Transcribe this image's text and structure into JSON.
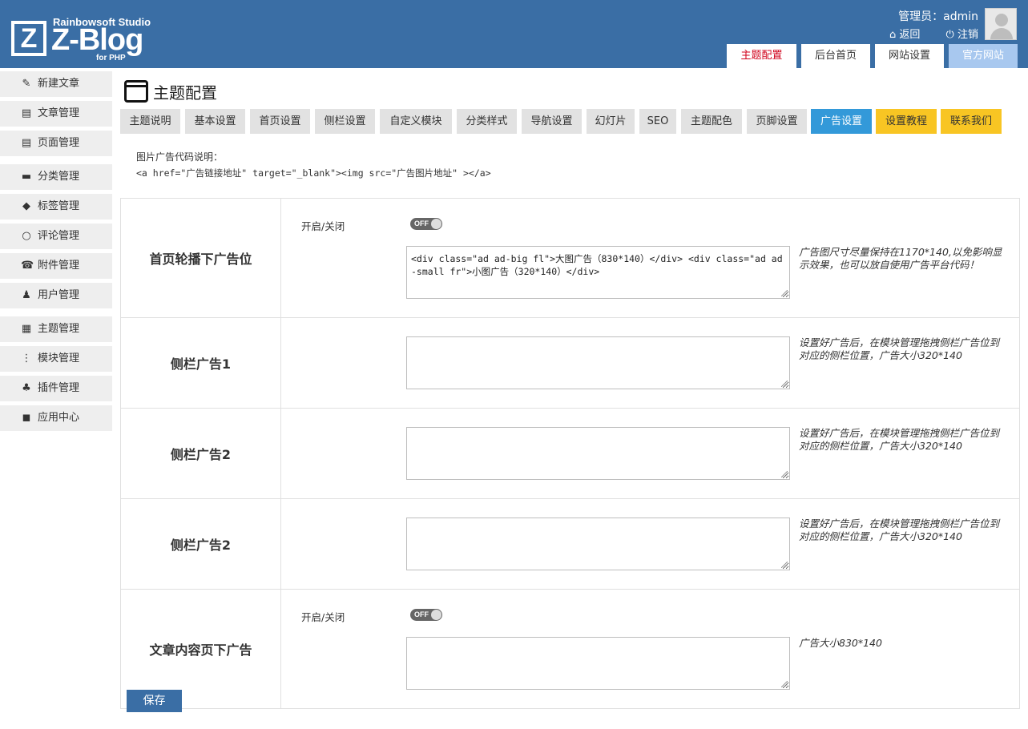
{
  "header": {
    "studio": "Rainbowsoft Studio",
    "brand": "Z-Blog",
    "brand_letter": "Z",
    "sub": "for PHP",
    "user_label": "管理员：admin",
    "back_label": "返回",
    "logout_label": "注销",
    "icons": {
      "back": "home-icon",
      "logout": "power-icon",
      "avatar": "avatar-icon"
    }
  },
  "top_tabs": [
    {
      "label": "主题配置",
      "active": true
    },
    {
      "label": "后台首页",
      "active": false
    },
    {
      "label": "网站设置",
      "active": false
    },
    {
      "label": "官方网站",
      "active": false
    }
  ],
  "sidebar": {
    "items": [
      {
        "label": "新建文章",
        "icon": "edit-icon",
        "glyph": "✎"
      },
      {
        "label": "文章管理",
        "icon": "article-icon",
        "glyph": "▤"
      },
      {
        "label": "页面管理",
        "icon": "page-icon",
        "glyph": "▤"
      },
      {
        "label": "分类管理",
        "icon": "folder-icon",
        "glyph": "▬"
      },
      {
        "label": "标签管理",
        "icon": "tag-icon",
        "glyph": "◆"
      },
      {
        "label": "评论管理",
        "icon": "comment-icon",
        "glyph": "○"
      },
      {
        "label": "附件管理",
        "icon": "attachment-icon",
        "glyph": "☎"
      },
      {
        "label": "用户管理",
        "icon": "user-icon",
        "glyph": "♟"
      },
      {
        "label": "主题管理",
        "icon": "theme-icon",
        "glyph": "▦"
      },
      {
        "label": "模块管理",
        "icon": "module-icon",
        "glyph": "⋮"
      },
      {
        "label": "插件管理",
        "icon": "plugin-icon",
        "glyph": "♣"
      },
      {
        "label": "应用中心",
        "icon": "app-center-icon",
        "glyph": "◼"
      }
    ]
  },
  "main": {
    "title": "主题配置",
    "tabs": [
      {
        "label": "主题说明",
        "style": "normal"
      },
      {
        "label": "基本设置",
        "style": "normal"
      },
      {
        "label": "首页设置",
        "style": "normal"
      },
      {
        "label": "侧栏设置",
        "style": "normal"
      },
      {
        "label": "自定义模块",
        "style": "normal"
      },
      {
        "label": "分类样式",
        "style": "normal"
      },
      {
        "label": "导航设置",
        "style": "normal"
      },
      {
        "label": "幻灯片",
        "style": "normal"
      },
      {
        "label": "SEO",
        "style": "normal"
      },
      {
        "label": "主题配色",
        "style": "normal"
      },
      {
        "label": "页脚设置",
        "style": "normal"
      },
      {
        "label": "广告设置",
        "style": "active"
      },
      {
        "label": "设置教程",
        "style": "yellow"
      },
      {
        "label": "联系我们",
        "style": "yellow"
      }
    ],
    "code_note_title": "图片广告代码说明：",
    "code_note_code": "<a href=\"广告链接地址\" target=\"_blank\"><img src=\"广告图片地址\" ></a>",
    "rows": [
      {
        "label": "首页轮播下广告位",
        "toggle_label": "开启/关闭",
        "toggle_text": "OFF",
        "value": "<div class=\"ad ad-big fl\">大图广告（830*140）</div> <div class=\"ad ad-small fr\">小图广告（320*140）</div>",
        "hint": "广告图尺寸尽量保持在1170*140,以免影响显示效果，也可以放自使用广告平台代码！"
      },
      {
        "label": "侧栏广告1",
        "value": "",
        "hint": "设置好广告后，在模块管理拖拽侧栏广告位到对应的侧栏位置，广告大小320*140"
      },
      {
        "label": "侧栏广告2",
        "value": "",
        "hint": "设置好广告后，在模块管理拖拽侧栏广告位到对应的侧栏位置，广告大小320*140"
      },
      {
        "label": "侧栏广告2",
        "value": "",
        "hint": "设置好广告后，在模块管理拖拽侧栏广告位到对应的侧栏位置，广告大小320*140"
      },
      {
        "label": "文章内容页下广告",
        "toggle_label": "开启/关闭",
        "toggle_text": "OFF",
        "value": "",
        "hint": "广告大小830*140"
      }
    ],
    "save_label": "保存"
  }
}
